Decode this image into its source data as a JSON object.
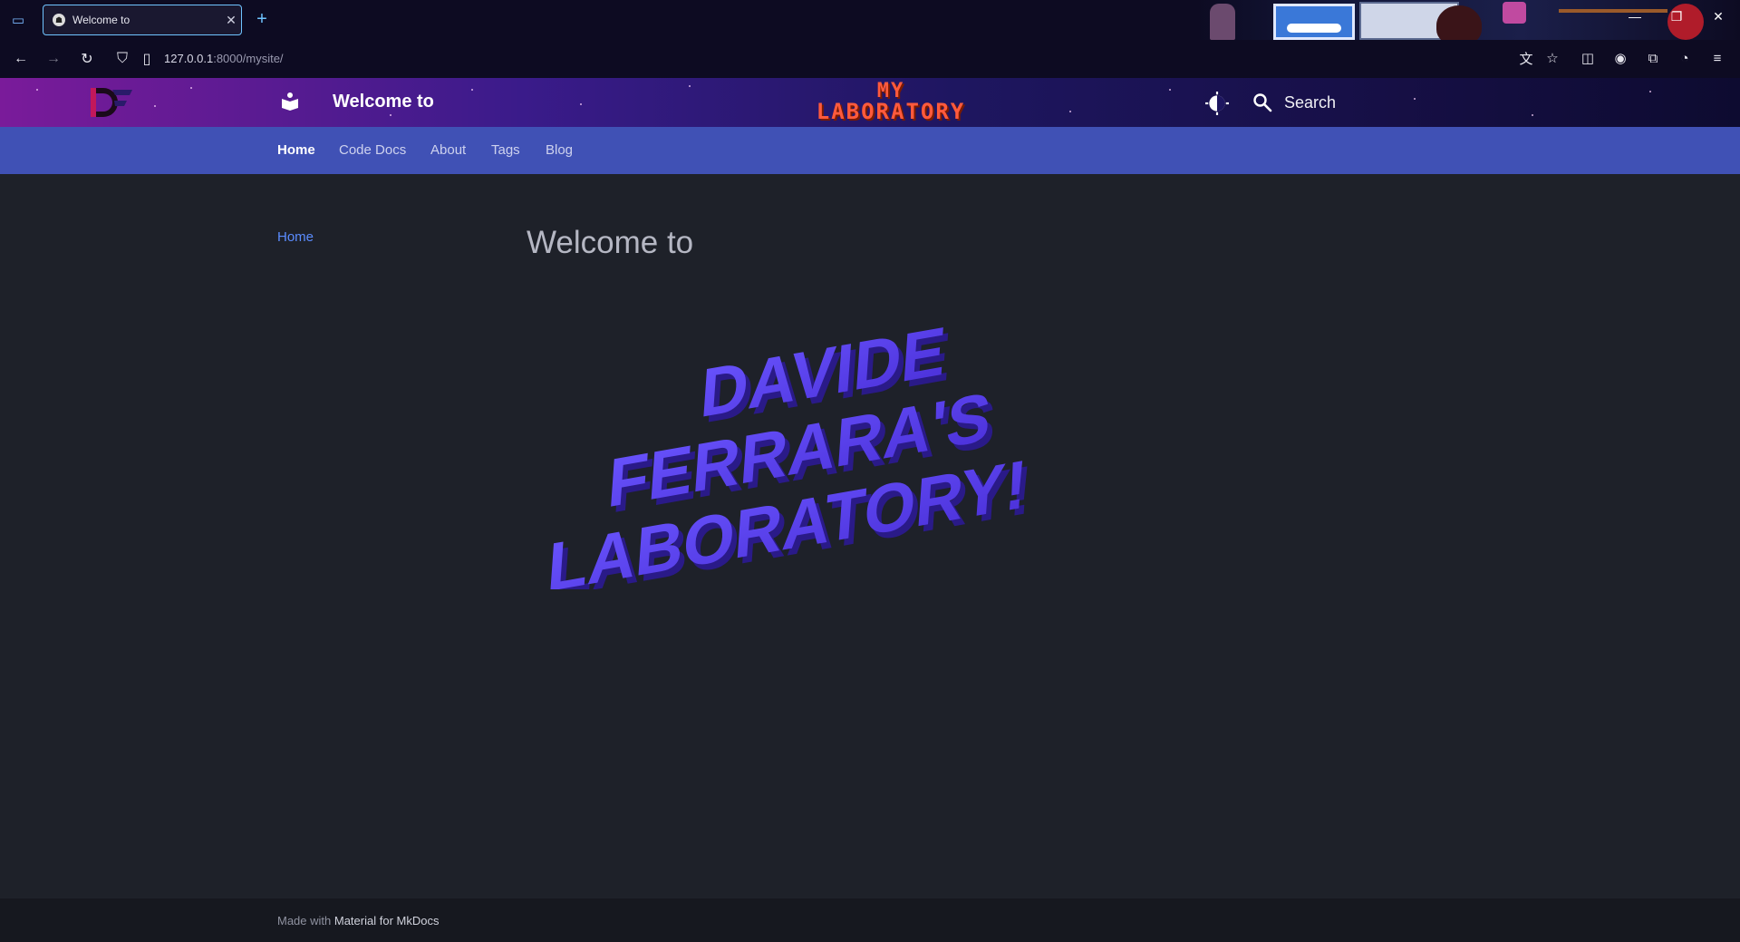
{
  "browser": {
    "tab_title": "Welcome to",
    "url_host": "127.0.0.1",
    "url_rest": ":8000/mysite/"
  },
  "site": {
    "title": "Welcome to",
    "banner_line1": "MY",
    "banner_line2": "LABORATORY",
    "search_placeholder": "Search"
  },
  "tabs": [
    {
      "label": "Home",
      "active": true
    },
    {
      "label": "Code Docs",
      "active": false
    },
    {
      "label": "About",
      "active": false
    },
    {
      "label": "Tags",
      "active": false
    },
    {
      "label": "Blog",
      "active": false
    }
  ],
  "sidebar": {
    "items": [
      {
        "label": "Home"
      }
    ]
  },
  "content": {
    "heading": "Welcome to",
    "hero_lines": [
      "DAVIDE",
      "FERRARA'S",
      "LABORATORY!"
    ]
  },
  "footer": {
    "prefix": "Made with",
    "link": "Material for MkDocs"
  },
  "colors": {
    "header_gradient_start": "#7a1b9a",
    "tabs_bg": "#4051b5",
    "page_bg": "#1e2129",
    "hero_text": "#5a3cf0",
    "link": "#5b8cff"
  }
}
